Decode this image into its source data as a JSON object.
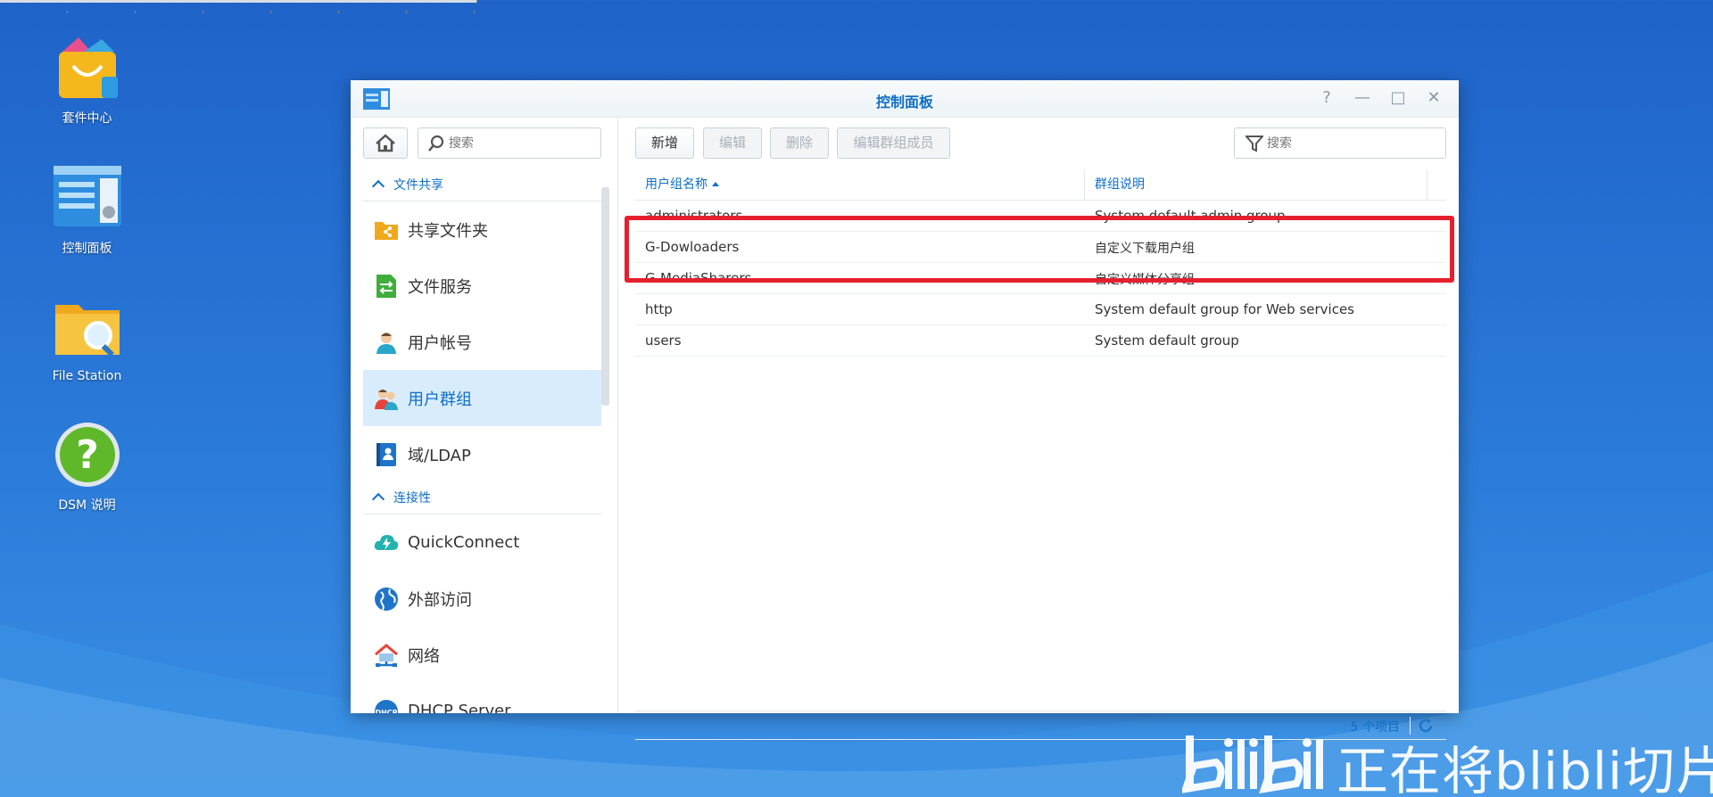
{
  "desktop": {
    "icons": [
      {
        "label": "套件中心"
      },
      {
        "label": "控制面板"
      },
      {
        "label": "File Station"
      },
      {
        "label": "DSM 说明"
      }
    ]
  },
  "window": {
    "title": "控制面板",
    "controls": {
      "help": "?",
      "minimize": "—",
      "maximize": "□",
      "close": "✕"
    }
  },
  "sidebar": {
    "search_placeholder": "搜索",
    "sections": [
      {
        "title": "文件共享",
        "items": [
          {
            "label": "共享文件夹",
            "icon": "shared-folder-icon"
          },
          {
            "label": "文件服务",
            "icon": "file-services-icon"
          },
          {
            "label": "用户帐号",
            "icon": "user-icon"
          },
          {
            "label": "用户群组",
            "icon": "group-icon",
            "active": true
          },
          {
            "label": "域/LDAP",
            "icon": "ldap-icon"
          }
        ]
      },
      {
        "title": "连接性",
        "items": [
          {
            "label": "QuickConnect",
            "icon": "quickconnect-icon"
          },
          {
            "label": "外部访问",
            "icon": "globe-icon"
          },
          {
            "label": "网络",
            "icon": "network-icon"
          },
          {
            "label": "DHCP Server",
            "icon": "dhcp-icon"
          }
        ]
      }
    ]
  },
  "toolbar": {
    "add": "新增",
    "edit": "编辑",
    "delete": "删除",
    "edit_members": "编辑群组成员",
    "filter_placeholder": "搜索"
  },
  "table": {
    "columns": [
      "用户组名称",
      "群组说明"
    ],
    "rows": [
      {
        "name": "administrators",
        "desc": "System default admin group"
      },
      {
        "name": "G-Dowloaders",
        "desc": "自定义下载用户组"
      },
      {
        "name": "G-MediaSharers",
        "desc": "自定义媒体分享组"
      },
      {
        "name": "http",
        "desc": "System default group for Web services"
      },
      {
        "name": "users",
        "desc": "System default group"
      }
    ],
    "item_count": "5 个项目"
  },
  "watermark": {
    "text": "正在将blibli切片"
  },
  "colors": {
    "accent": "#0f6fc6",
    "highlight": "#e5202e",
    "active_bg": "#d9ecfb"
  }
}
